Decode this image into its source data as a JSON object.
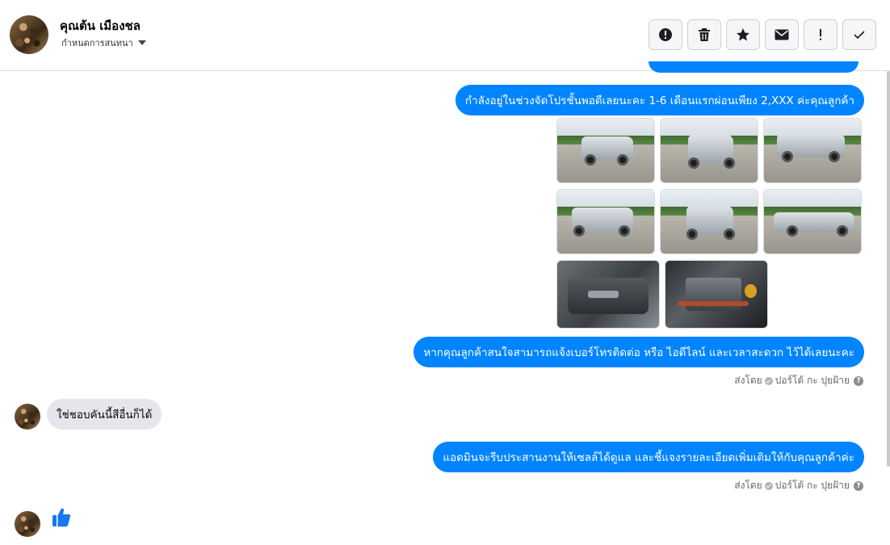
{
  "header": {
    "contact_name": "คุณต้น เมืองชล",
    "subtitle": "กำหนดการสนทนา",
    "toolbar": [
      {
        "icon": "alert-circle-icon",
        "name": "report-button"
      },
      {
        "icon": "trash-icon",
        "name": "delete-button"
      },
      {
        "icon": "star-icon",
        "name": "star-button"
      },
      {
        "icon": "envelope-icon",
        "name": "mark-unread-button"
      },
      {
        "icon": "exclamation-icon",
        "name": "spam-button"
      },
      {
        "icon": "check-icon",
        "name": "done-button"
      }
    ]
  },
  "messages": [
    {
      "direction": "outgoing",
      "text": "กำลังอยู่ในช่วงจัดโปรชั้นพอดีเลยนะคะ 1-6 เดือนแรกผ่อนเพียง 2,XXX  ค่ะคุณลูกค้า"
    },
    {
      "direction": "outgoing",
      "type": "photos",
      "count": 8
    },
    {
      "direction": "outgoing",
      "text": "หากคุณลูกค้าสนใจสามารถแจ้งเบอร์โทรติดต่อ หรือ ไอดีไลน์ และเวลาสะดวก ไว้ได้เลยนะคะ",
      "sent_by": "ส่งโดย",
      "sender": "ปอร์โต้ กะ ปุยฝ้าย"
    },
    {
      "direction": "incoming",
      "text": "ใช่ชอบคันนี้สีอื่นก็ได้"
    },
    {
      "direction": "outgoing",
      "text": "แอดมินจะรีบประสานงานให้เซลล์ได้ดูแล และชี้แจงรายละเอียดเพิ่มเติมให้กับคุณลูกค้าค่ะ",
      "sent_by": "ส่งโดย",
      "sender": "ปอร์โต้ กะ ปุยฝ้าย"
    },
    {
      "direction": "incoming",
      "type": "like"
    }
  ],
  "colors": {
    "outgoing_bubble": "#0084ff",
    "incoming_bubble": "#e4e6eb",
    "like": "#1877f2"
  }
}
